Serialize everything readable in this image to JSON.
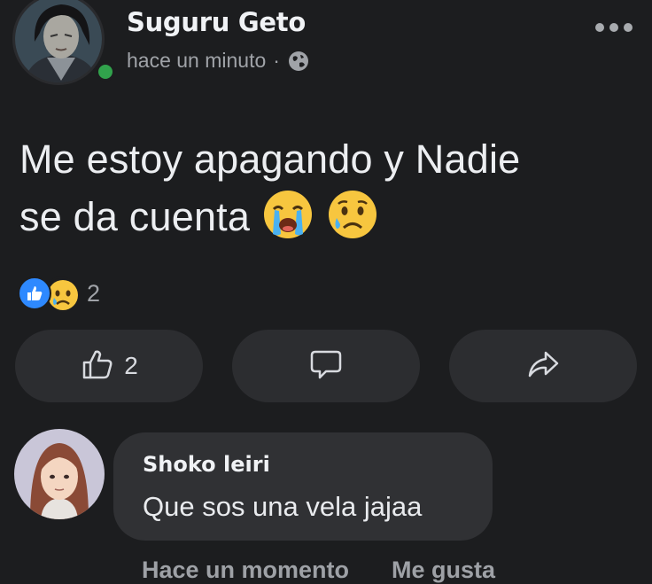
{
  "post": {
    "author": "Suguru Geto",
    "timestamp": "hace un minuto",
    "separator": "·",
    "privacy_icon": "globe-icon",
    "text_line1": "Me estoy apagando y Nadie",
    "text_line2": "se da cuenta",
    "text_emojis": [
      "loudly-crying-face",
      "sad-but-relieved-face"
    ]
  },
  "reactions": {
    "types": [
      "like",
      "sad"
    ],
    "count": "2"
  },
  "actions": {
    "like_count": "2",
    "like_icon": "thumbs-up-icon",
    "comment_icon": "comment-icon",
    "share_icon": "share-icon"
  },
  "comment": {
    "author": "Shoko leiri",
    "text": "Que sos una vela jajaa",
    "time": "Hace un momento",
    "like_label": "Me gusta"
  },
  "colors": {
    "background": "#1c1d1f",
    "button_bg": "#2c2d30",
    "bubble_bg": "#303134",
    "like_blue": "#2e89ff",
    "online_green": "#31a24c"
  }
}
